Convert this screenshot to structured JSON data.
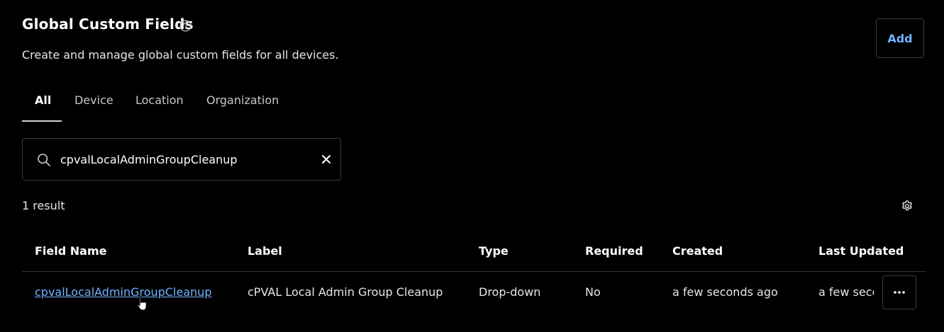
{
  "header": {
    "title": "Global Custom Fields",
    "subtitle": "Create and manage global custom fields for all devices.",
    "add_label": "Add",
    "help_icon": "question-circle-icon"
  },
  "tabs": [
    {
      "label": "All",
      "active": true
    },
    {
      "label": "Device",
      "active": false
    },
    {
      "label": "Location",
      "active": false
    },
    {
      "label": "Organization",
      "active": false
    }
  ],
  "search": {
    "value": "cpvalLocalAdminGroupCleanup",
    "placeholder": "",
    "icon": "search-icon",
    "clear_icon": "close-icon"
  },
  "results": {
    "count_text": "1 result",
    "settings_icon": "gear-icon"
  },
  "table": {
    "columns": [
      "Field Name",
      "Label",
      "Type",
      "Required",
      "Created",
      "Last Updated"
    ],
    "rows": [
      {
        "field_name": "cpvalLocalAdminGroupCleanup",
        "label": "cPVAL Local Admin Group Cleanup",
        "type": "Drop-down",
        "required": "No",
        "created": "a few seconds ago",
        "last_updated": "a few seconds ago",
        "actions_icon": "ellipsis-icon"
      }
    ]
  },
  "colors": {
    "background": "#000000",
    "accent": "#6fb3ff",
    "border": "#3a3a3a",
    "text": "#ffffff"
  }
}
